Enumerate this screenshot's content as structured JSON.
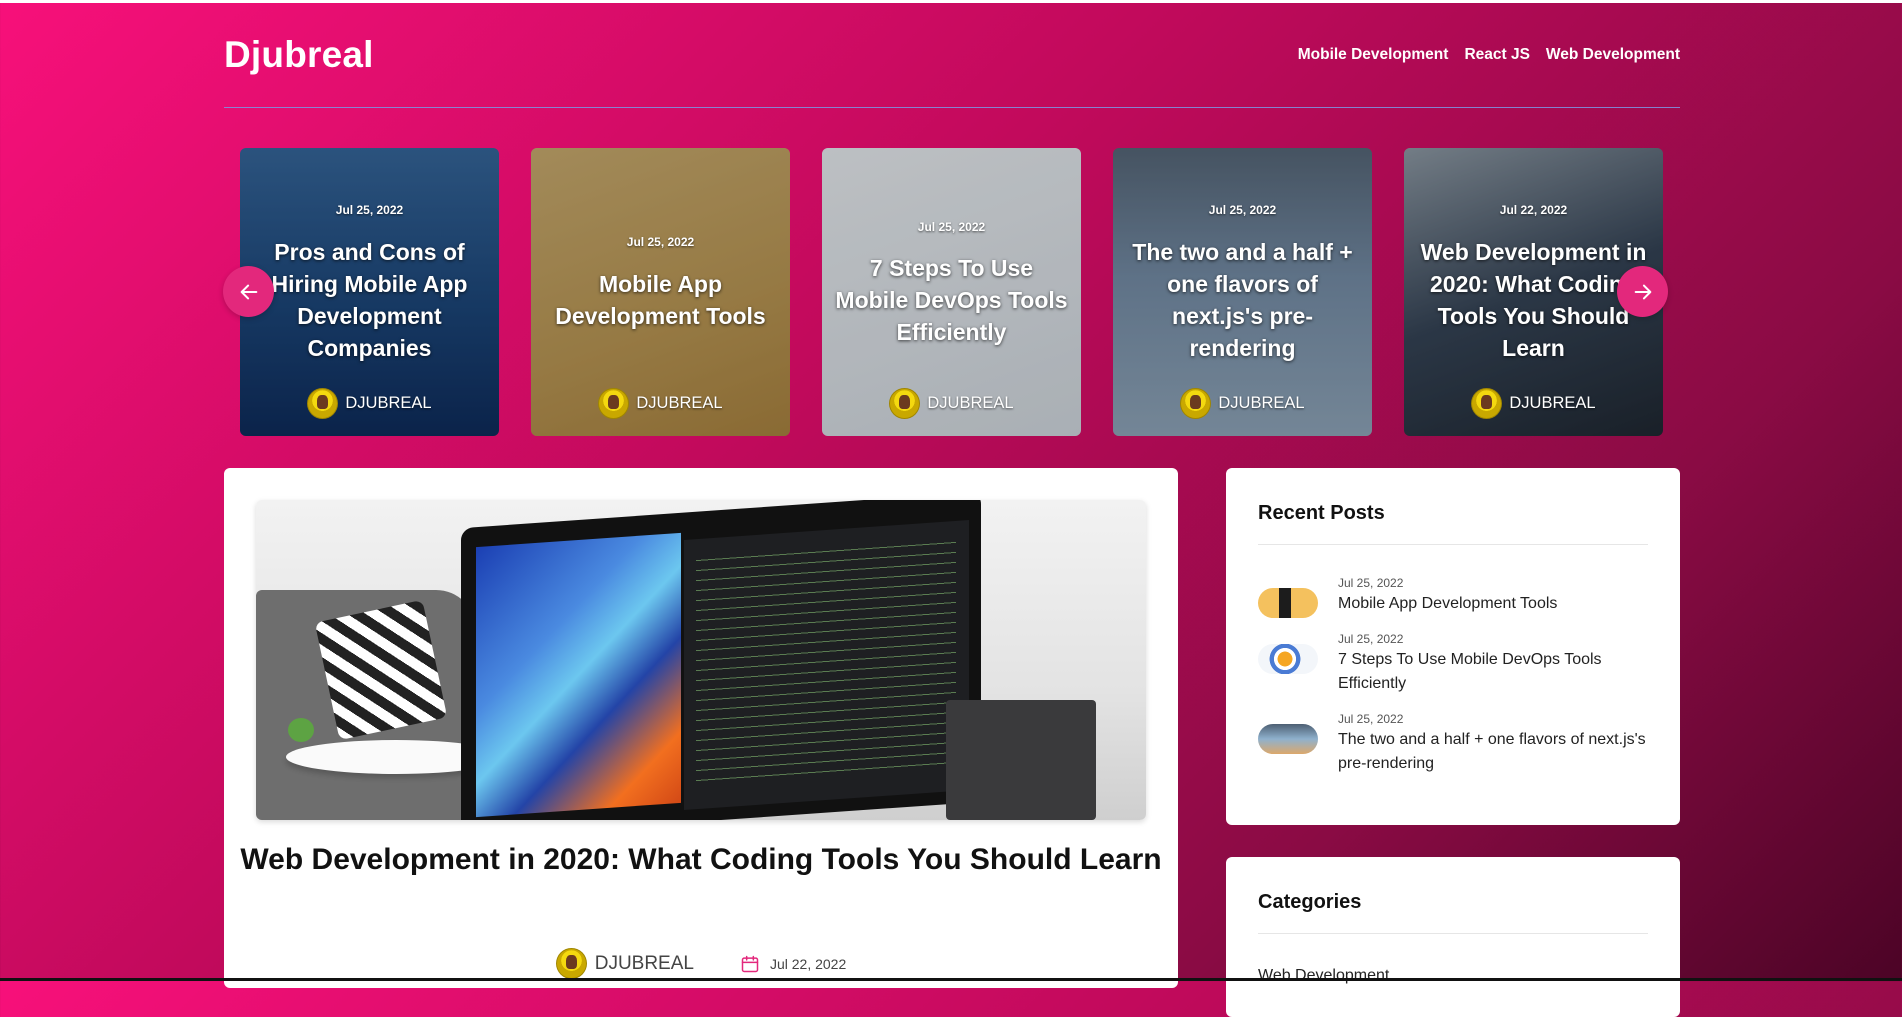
{
  "site": {
    "logo": "Djubreal"
  },
  "nav": [
    {
      "label": "Mobile Development"
    },
    {
      "label": "React JS"
    },
    {
      "label": "Web Development"
    }
  ],
  "carousel": [
    {
      "date": "Jul 25, 2022",
      "title": "Pros and Cons of Hiring Mobile App Development Companies",
      "author": "DJUBREAL"
    },
    {
      "date": "Jul 25, 2022",
      "title": "Mobile App Development Tools",
      "author": "DJUBREAL"
    },
    {
      "date": "Jul 25, 2022",
      "title": "7 Steps To Use Mobile DevOps Tools Efficiently",
      "author": "DJUBREAL"
    },
    {
      "date": "Jul 25, 2022",
      "title": "The two and a half + one flavors of next.js's pre-rendering",
      "author": "DJUBREAL"
    },
    {
      "date": "Jul 22, 2022",
      "title": "Web Development in 2020: What Coding Tools You Should Learn",
      "author": "DJUBREAL"
    }
  ],
  "carousel_controls": {
    "prev_icon": "arrow-left-icon",
    "next_icon": "arrow-right-icon"
  },
  "post": {
    "title": "Web Development in 2020: What Coding Tools You Should Learn",
    "author": "DJUBREAL",
    "date": "Jul 22, 2022"
  },
  "recent_posts": {
    "heading": "Recent Posts",
    "items": [
      {
        "date": "Jul 25, 2022",
        "title": "Mobile App Development Tools"
      },
      {
        "date": "Jul 25, 2022",
        "title": "7 Steps To Use Mobile DevOps Tools Efficiently"
      },
      {
        "date": "Jul 25, 2022",
        "title": "The two and a half + one flavors of next.js's pre-rendering"
      }
    ]
  },
  "categories": {
    "heading": "Categories",
    "items": [
      {
        "label": "Web Development"
      }
    ]
  },
  "colors": {
    "accent": "#e3287c",
    "gradient_start": "#f7107a",
    "gradient_end": "#4c0426"
  }
}
